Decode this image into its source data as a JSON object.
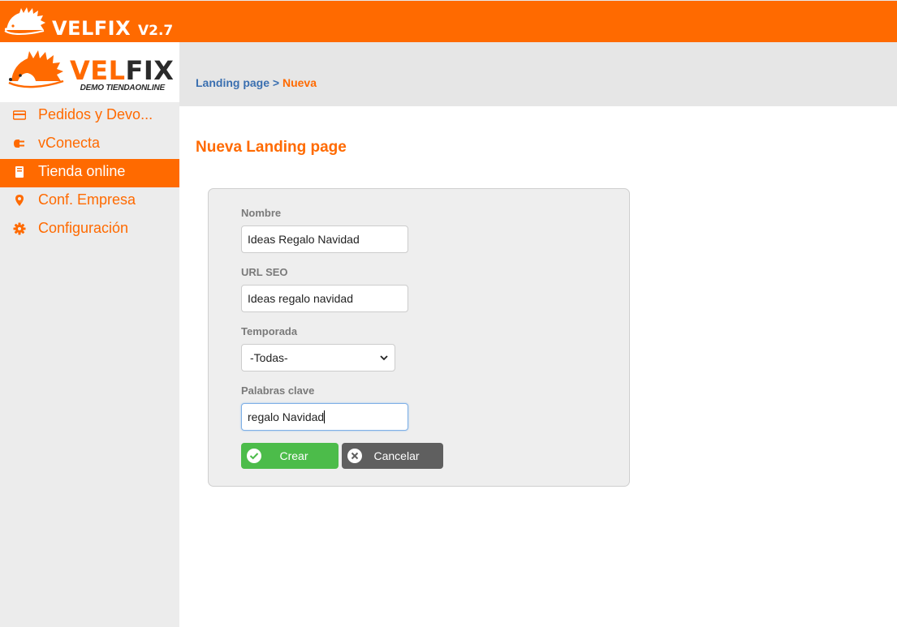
{
  "header": {
    "brand": "VELFIX",
    "version": "V2.7"
  },
  "logo": {
    "word_a": "VEL",
    "word_b": "FIX",
    "subtitle": "DEMO TIENDAONLINE"
  },
  "sidebar": {
    "items": [
      {
        "label": "Pedidos y Devo...",
        "icon": "credit-card-icon",
        "active": false
      },
      {
        "label": "vConecta",
        "icon": "plug-icon",
        "active": false
      },
      {
        "label": "Tienda online",
        "icon": "book-icon",
        "active": true
      },
      {
        "label": "Conf. Empresa",
        "icon": "map-pin-icon",
        "active": false
      },
      {
        "label": "Configuración",
        "icon": "gear-icon",
        "active": false
      }
    ]
  },
  "breadcrumb": {
    "parent": "Landing page",
    "separator": ">",
    "current": "Nueva"
  },
  "page": {
    "title": "Nueva Landing page"
  },
  "form": {
    "nombre_label": "Nombre",
    "nombre_value": "Ideas Regalo Navidad",
    "url_label": "URL SEO",
    "url_value": "Ideas regalo navidad",
    "temporada_label": "Temporada",
    "temporada_value": "-Todas-",
    "palabras_label": "Palabras clave",
    "palabras_value": "regalo Navidad"
  },
  "buttons": {
    "create": "Crear",
    "cancel": "Cancelar"
  },
  "colors": {
    "brand_orange": "#ff6a00",
    "success_green": "#4cbc4a",
    "cancel_gray": "#5f5f5f",
    "link_blue": "#3a6fb0"
  }
}
